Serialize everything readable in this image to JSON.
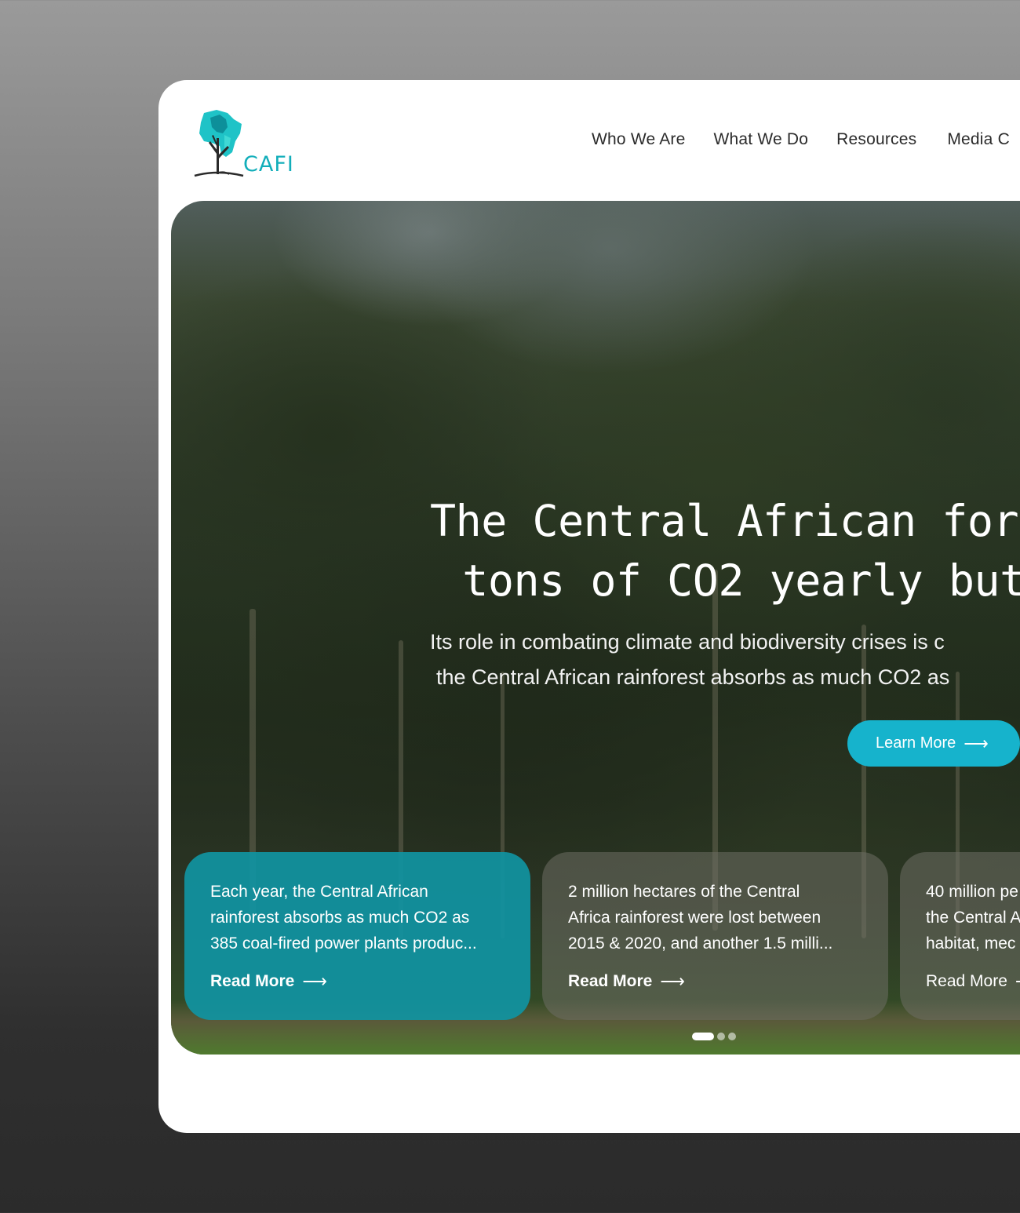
{
  "brand": {
    "name": "CAFI",
    "accent_color": "#12aeba",
    "logo_icon": "africa-tree-logo"
  },
  "nav": {
    "items": [
      {
        "label": "Who We Are"
      },
      {
        "label": "What We Do"
      },
      {
        "label": "Resources"
      },
      {
        "label": "Media C"
      }
    ]
  },
  "hero": {
    "title_line1": "The Central African forest",
    "title_line2": "tons of CO2 yearly but",
    "subtitle_line1": "Its role in combating climate and biodiversity crises is c",
    "subtitle_line2": "the Central African rainforest absorbs as much CO2 as",
    "cta_label": "Learn More",
    "cta_color": "#16b3cc"
  },
  "cards": [
    {
      "lines": [
        "Each year, the Central African",
        "rainforest absorbs as much CO2 as",
        "385 coal-fired power plants produc..."
      ],
      "link": "Read More"
    },
    {
      "lines": [
        "2 million hectares of the Central",
        "Africa rainforest were lost between",
        "2015 & 2020, and another 1.5 milli..."
      ],
      "link": "Read More"
    },
    {
      "lines": [
        "40 million pe",
        "the Central A",
        "habitat, mec"
      ],
      "link": "Read More"
    }
  ],
  "carousel": {
    "total": 3,
    "active_index": 0
  }
}
